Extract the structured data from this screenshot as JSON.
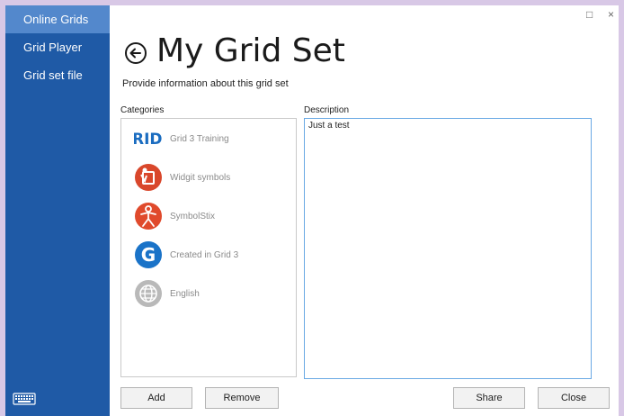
{
  "sidebar": {
    "items": [
      {
        "label": "Online Grids"
      },
      {
        "label": "Grid Player"
      },
      {
        "label": "Grid set file"
      }
    ]
  },
  "window": {
    "maximize_icon": "square-icon",
    "close_icon": "x-icon",
    "maximize_glyph": "□",
    "close_glyph": "×"
  },
  "page": {
    "title": "My Grid Set",
    "subtitle": "Provide information about this grid set"
  },
  "categories": {
    "label": "Categories",
    "items": [
      {
        "label": "Grid 3 Training",
        "logo_text": "RID)"
      },
      {
        "label": "Widgit symbols"
      },
      {
        "label": "SymbolStix"
      },
      {
        "label": "Created in Grid 3",
        "logo_text": "G"
      },
      {
        "label": "English"
      }
    ]
  },
  "description": {
    "label": "Description",
    "value": "Just a test"
  },
  "buttons": {
    "add": "Add",
    "remove": "Remove",
    "share": "Share",
    "close": "Close"
  },
  "colors": {
    "sidebar": "#1f5aa6",
    "sidebar_active": "#5388cc",
    "accent_border": "#6aa9e4",
    "widgit_red": "#d9472b",
    "symbolstix_red": "#e04a2c",
    "grid_blue": "#1a73c8"
  }
}
